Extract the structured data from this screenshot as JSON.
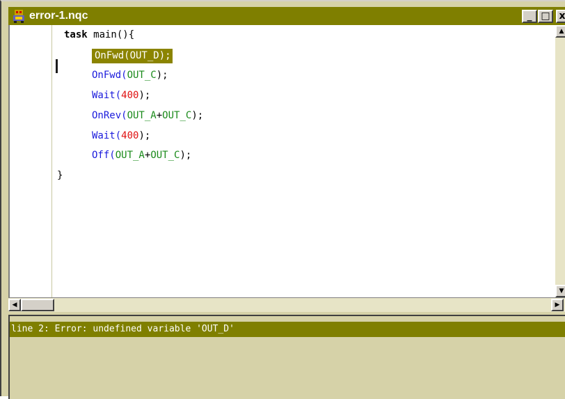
{
  "window": {
    "title": "error-1.nqc",
    "minimize_label": "_",
    "maximize_label": "□",
    "close_label": "x"
  },
  "editor": {
    "lines": [
      {
        "tokens": [
          {
            "t": "task",
            "k": "kw"
          },
          {
            "t": " main(){",
            "k": "blk"
          }
        ]
      },
      {
        "tokens": [
          {
            "t": "OnFwd(OUT_D);",
            "k": "hl"
          }
        ],
        "highlighted": true
      },
      {
        "tokens": [
          {
            "t": "OnFwd(",
            "k": "fn"
          },
          {
            "t": "OUT_C",
            "k": "cn"
          },
          {
            "t": ");",
            "k": "blk"
          }
        ]
      },
      {
        "tokens": [
          {
            "t": "Wait(",
            "k": "fn"
          },
          {
            "t": "400",
            "k": "num"
          },
          {
            "t": ");",
            "k": "blk"
          }
        ]
      },
      {
        "tokens": [
          {
            "t": "OnRev(",
            "k": "fn"
          },
          {
            "t": "OUT_A",
            "k": "cn"
          },
          {
            "t": "+",
            "k": "blk"
          },
          {
            "t": "OUT_C",
            "k": "cn"
          },
          {
            "t": ");",
            "k": "blk"
          }
        ]
      },
      {
        "tokens": [
          {
            "t": "Wait(",
            "k": "fn"
          },
          {
            "t": "400",
            "k": "num"
          },
          {
            "t": ");",
            "k": "blk"
          }
        ]
      },
      {
        "tokens": [
          {
            "t": "Off(",
            "k": "fn"
          },
          {
            "t": "OUT_A",
            "k": "cn"
          },
          {
            "t": "+",
            "k": "blk"
          },
          {
            "t": "OUT_C",
            "k": "cn"
          },
          {
            "t": ");",
            "k": "blk"
          }
        ]
      },
      {
        "tokens": [
          {
            "t": "}",
            "k": "blk"
          }
        ]
      }
    ]
  },
  "errors": {
    "message": "line 2: Error: undefined variable 'OUT_D'"
  },
  "icons": {
    "app": "nqc-robot-icon",
    "scroll_up": "arrow-up-icon",
    "scroll_down": "arrow-down-icon",
    "scroll_left": "arrow-left-icon",
    "scroll_right": "arrow-right-icon"
  },
  "colors": {
    "titlebar": "#7f7f00",
    "panel": "#d6d2a8",
    "keyword": "#000000",
    "function": "#1a1adc",
    "constant": "#1a8a1a",
    "number": "#e01010",
    "highlight": "#8b8400"
  }
}
